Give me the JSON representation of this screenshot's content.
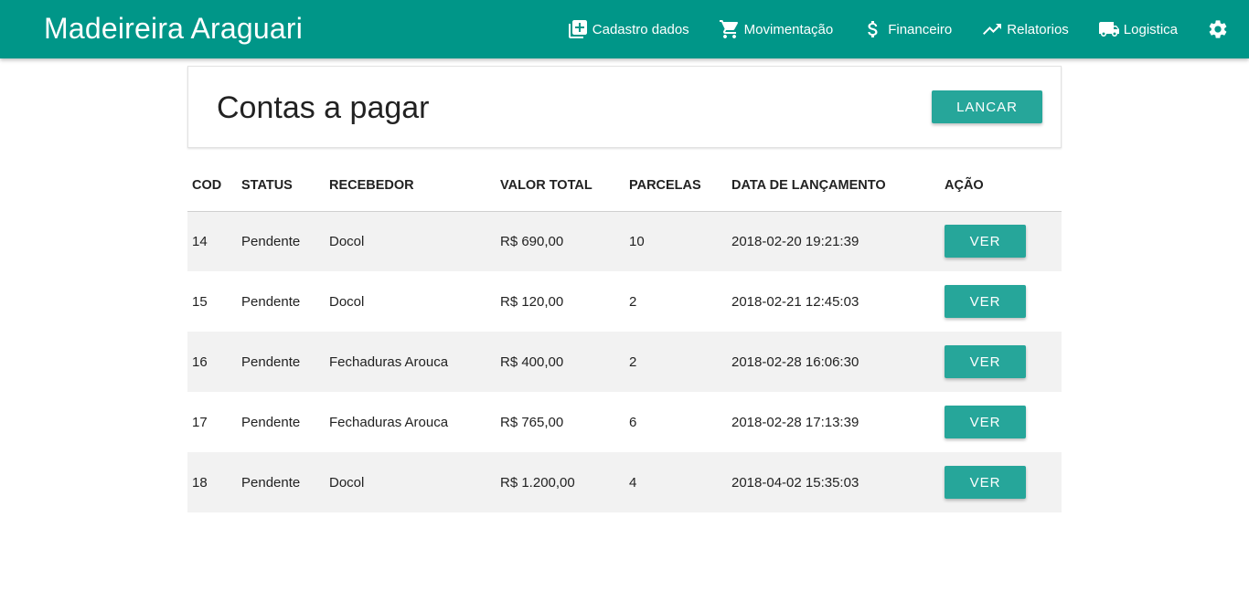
{
  "app": {
    "title": "Madeireira Araguari"
  },
  "nav": {
    "items": [
      {
        "label": "Cadastro dados",
        "icon": "library-add-icon"
      },
      {
        "label": "Movimentação",
        "icon": "shopping-cart-icon"
      },
      {
        "label": "Financeiro",
        "icon": "dollar-icon"
      },
      {
        "label": "Relatorios",
        "icon": "trending-up-icon"
      },
      {
        "label": "Logistica",
        "icon": "truck-icon"
      }
    ],
    "settings_icon": "gear-icon"
  },
  "page": {
    "title": "Contas a pagar",
    "action_label": "LANCAR"
  },
  "table": {
    "columns": [
      "COD",
      "STATUS",
      "RECEBEDOR",
      "VALOR TOTAL",
      "PARCELAS",
      "DATA DE LANÇAMENTO",
      "AÇÃO"
    ],
    "rows": [
      {
        "cod": "14",
        "status": "Pendente",
        "recebedor": "Docol",
        "valor": "R$ 690,00",
        "parcelas": "10",
        "data": "2018-02-20 19:21:39",
        "acao": "VER"
      },
      {
        "cod": "15",
        "status": "Pendente",
        "recebedor": "Docol",
        "valor": "R$ 120,00",
        "parcelas": "2",
        "data": "2018-02-21 12:45:03",
        "acao": "VER"
      },
      {
        "cod": "16",
        "status": "Pendente",
        "recebedor": "Fechaduras Arouca",
        "valor": "R$ 400,00",
        "parcelas": "2",
        "data": "2018-02-28 16:06:30",
        "acao": "VER"
      },
      {
        "cod": "17",
        "status": "Pendente",
        "recebedor": "Fechaduras Arouca",
        "valor": "R$ 765,00",
        "parcelas": "6",
        "data": "2018-02-28 17:13:39",
        "acao": "VER"
      },
      {
        "cod": "18",
        "status": "Pendente",
        "recebedor": "Docol",
        "valor": "R$ 1.200,00",
        "parcelas": "4",
        "data": "2018-04-02 15:35:03",
        "acao": "VER"
      }
    ]
  },
  "colors": {
    "navbar": "#009688",
    "button": "#26a69a",
    "row_stripe": "#f2f2f2"
  }
}
